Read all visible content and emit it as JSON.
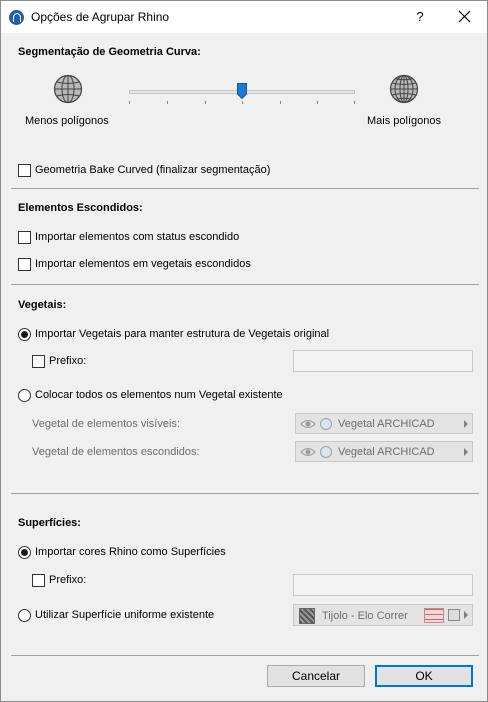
{
  "window": {
    "title": "Opções de Agrupar Rhino"
  },
  "titlebar": {
    "help_label": "?"
  },
  "segmentation": {
    "heading": "Segmentação de Geometria Curva:",
    "min_label": "Menos polígonos",
    "max_label": "Mais polígonos",
    "bake_label": "Geometria Bake Curved (finalizar segmentação)",
    "bake_checked": false
  },
  "hidden": {
    "heading": "Elementos Escondidos:",
    "import_hidden_label": "Importar elementos com status escondido",
    "import_hidden_checked": false,
    "import_hidden_layers_label": "Importar elementos em vegetais escondidos",
    "import_hidden_layers_checked": false
  },
  "layers": {
    "heading": "Vegetais:",
    "option_keep_label": "Importar Vegetais para manter estrutura de Vegetais original",
    "option_keep_selected": true,
    "prefix_label": "Prefixo:",
    "prefix_value": "",
    "option_existing_label": "Colocar todos os elementos num Vegetal existente",
    "option_existing_selected": false,
    "visible_label": "Vegetal de elementos visíveis:",
    "visible_value": "Vegetal ARCHICAD",
    "hidden_label": "Vegetal de elementos escondidos:",
    "hidden_value": "Vegetal ARCHICAD"
  },
  "surfaces": {
    "heading": "Superfícies:",
    "option_import_label": "Importar cores Rhino como Superfícies",
    "option_import_selected": true,
    "prefix_label": "Prefixo:",
    "prefix_value": "",
    "option_uniform_label": "Utilizar Superfície uniforme existente",
    "option_uniform_selected": false,
    "surface_value": "Tijolo - Elo Correr"
  },
  "footer": {
    "cancel_label": "Cancelar",
    "ok_label": "OK"
  },
  "icons": {
    "app": "archicad-app-icon",
    "globe": "globe-icon",
    "eye": "eye-icon",
    "layer": "layer-icon",
    "brick": "brick-pattern-icon"
  },
  "colors": {
    "accent": "#0078d7",
    "thumb": "#1f78d1"
  }
}
